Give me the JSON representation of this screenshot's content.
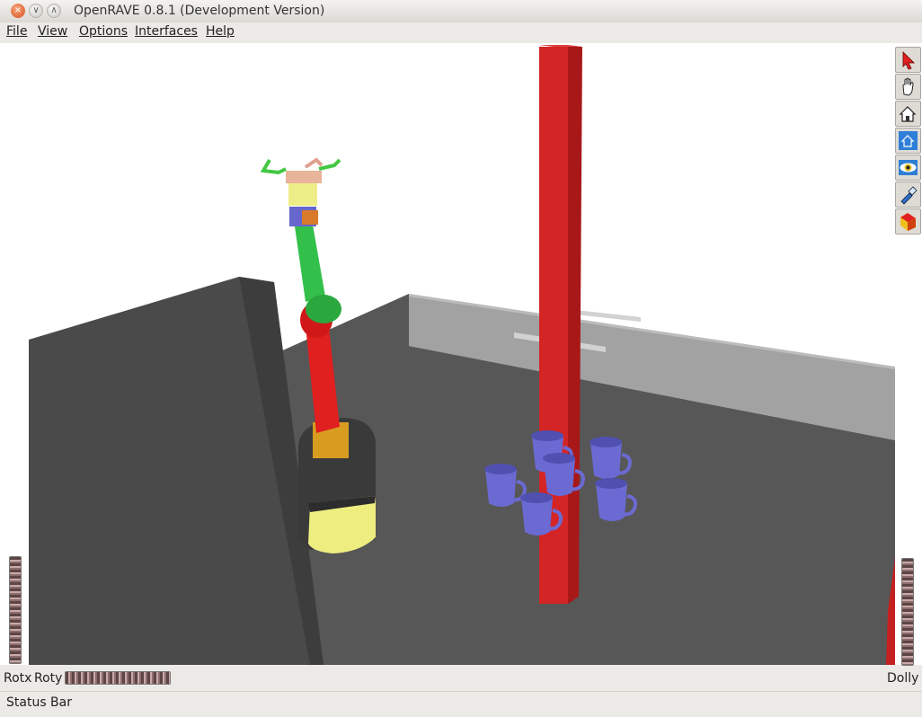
{
  "window": {
    "title": "OpenRAVE 0.8.1 (Development Version)",
    "buttons": [
      {
        "name": "close",
        "glyph": "×"
      },
      {
        "name": "minimize",
        "glyph": "∨"
      },
      {
        "name": "maximize",
        "glyph": "∧"
      }
    ]
  },
  "menubar": {
    "items": [
      {
        "label": "File",
        "mnemonic": "F"
      },
      {
        "label": "View",
        "mnemonic": "V"
      },
      {
        "label": "Options",
        "mnemonic": "O"
      },
      {
        "label": "Interfaces",
        "mnemonic": "I"
      },
      {
        "label": "Help",
        "mnemonic": "H"
      }
    ]
  },
  "toolbar": {
    "tools": [
      {
        "name": "select-pointer-icon",
        "active": false
      },
      {
        "name": "pan-hand-icon",
        "active": false
      },
      {
        "name": "home-view-icon",
        "active": false
      },
      {
        "name": "view-all-icon",
        "active": true
      },
      {
        "name": "seek-eye-icon",
        "active": false
      },
      {
        "name": "headlight-flashlight-icon",
        "active": false
      },
      {
        "name": "perspective-toggle-icon",
        "active": false
      }
    ]
  },
  "controls": {
    "rotx_label": "Rotx",
    "roty_label": "Roty",
    "dolly_label": "Dolly"
  },
  "status": {
    "text": "Status Bar"
  },
  "scene": {
    "colors": {
      "background": "#ffffff",
      "floor": "#575757",
      "table": "#4a4a4a",
      "pole": "#d12424",
      "mug": "#6b6ad3",
      "arm_green": "#33c04a",
      "arm_red": "#e01f1f",
      "arm_yellow": "#eeee82"
    },
    "mug_count": 6
  }
}
